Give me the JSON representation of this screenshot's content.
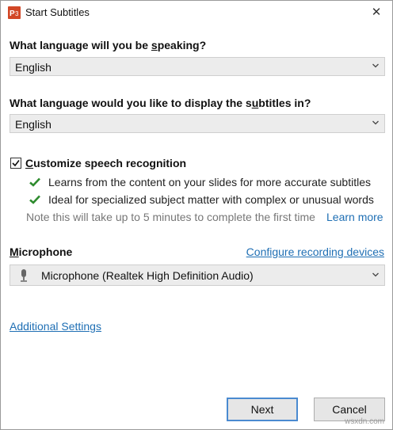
{
  "window": {
    "title": "Start Subtitles",
    "app_icon": "powerpoint-icon",
    "close_symbol": "✕"
  },
  "speak_language": {
    "label_pre": "What language will you be ",
    "label_u": "s",
    "label_post": "peaking?",
    "value": "English"
  },
  "subtitle_language": {
    "label_pre": "What language would you like to display the s",
    "label_u": "u",
    "label_post": "btitles in?",
    "value": "English"
  },
  "customize": {
    "checked": true,
    "label_u": "C",
    "label_post": "ustomize speech recognition",
    "items": [
      "Learns from the content on your slides for more accurate subtitles",
      "Ideal for specialized subject matter with complex or unusual words"
    ],
    "note": "Note this will take up to 5 minutes to complete the first time",
    "learn_more": "Learn more"
  },
  "microphone": {
    "label_u": "M",
    "label_post": "icrophone",
    "configure_link": "Configure recording devices",
    "value": "Microphone (Realtek High Definition Audio)"
  },
  "additional_settings": "Additional Settings",
  "buttons": {
    "next": "Next",
    "cancel": "Cancel"
  },
  "watermark": "wsxdn.com",
  "colors": {
    "link": "#1f6fb4",
    "check": "#2e8b2e",
    "accent": "#4a8ad0"
  }
}
